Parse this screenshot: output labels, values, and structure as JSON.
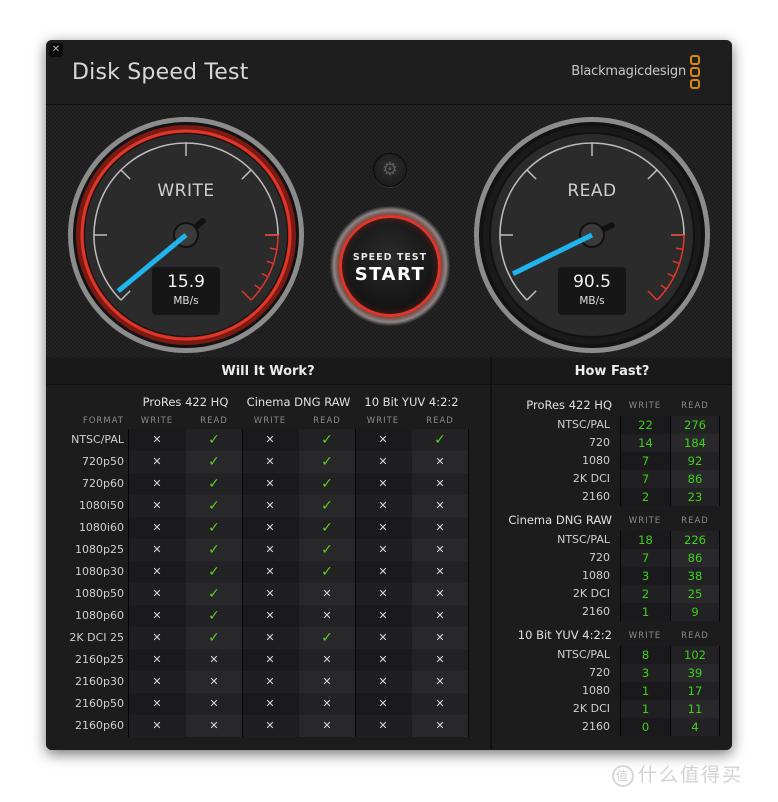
{
  "window": {
    "close_icon": "close-icon",
    "title": "Disk Speed Test",
    "brand": "Blackmagicdesign",
    "brand_logo_color": "#d68a15"
  },
  "gauges": {
    "write": {
      "label": "WRITE",
      "value": "15.9",
      "unit": "MB/s",
      "needle_fraction": 0.02,
      "ring_color": "#e0362a"
    },
    "read": {
      "label": "READ",
      "value": "90.5",
      "unit": "MB/s",
      "needle_fraction": 0.07,
      "ring_color": "#9a9a9a"
    },
    "needle_color": "#1fb4ee"
  },
  "controls": {
    "settings_icon": "gear-icon",
    "start_sub": "SPEED TEST",
    "start_main": "START"
  },
  "will_it_work": {
    "title": "Will It Work?",
    "format_header": "FORMAT",
    "codecs": [
      "ProRes 422 HQ",
      "Cinema DNG RAW",
      "10 Bit YUV 4:2:2"
    ],
    "subheaders": [
      "WRITE",
      "READ"
    ],
    "rows": [
      {
        "format": "NTSC/PAL",
        "cells": [
          "x",
          "ok",
          "x",
          "ok",
          "x",
          "ok"
        ]
      },
      {
        "format": "720p50",
        "cells": [
          "x",
          "ok",
          "x",
          "ok",
          "x",
          "x"
        ]
      },
      {
        "format": "720p60",
        "cells": [
          "x",
          "ok",
          "x",
          "ok",
          "x",
          "x"
        ]
      },
      {
        "format": "1080i50",
        "cells": [
          "x",
          "ok",
          "x",
          "ok",
          "x",
          "x"
        ]
      },
      {
        "format": "1080i60",
        "cells": [
          "x",
          "ok",
          "x",
          "ok",
          "x",
          "x"
        ]
      },
      {
        "format": "1080p25",
        "cells": [
          "x",
          "ok",
          "x",
          "ok",
          "x",
          "x"
        ]
      },
      {
        "format": "1080p30",
        "cells": [
          "x",
          "ok",
          "x",
          "ok",
          "x",
          "x"
        ]
      },
      {
        "format": "1080p50",
        "cells": [
          "x",
          "ok",
          "x",
          "x",
          "x",
          "x"
        ]
      },
      {
        "format": "1080p60",
        "cells": [
          "x",
          "ok",
          "x",
          "x",
          "x",
          "x"
        ]
      },
      {
        "format": "2K DCI 25",
        "cells": [
          "x",
          "ok",
          "x",
          "ok",
          "x",
          "x"
        ]
      },
      {
        "format": "2160p25",
        "cells": [
          "x",
          "x",
          "x",
          "x",
          "x",
          "x"
        ]
      },
      {
        "format": "2160p30",
        "cells": [
          "x",
          "x",
          "x",
          "x",
          "x",
          "x"
        ]
      },
      {
        "format": "2160p50",
        "cells": [
          "x",
          "x",
          "x",
          "x",
          "x",
          "x"
        ]
      },
      {
        "format": "2160p60",
        "cells": [
          "x",
          "x",
          "x",
          "x",
          "x",
          "x"
        ]
      }
    ],
    "check_color": "#59d11b",
    "cross_color": "#d4d4d4"
  },
  "how_fast": {
    "title": "How Fast?",
    "write_header": "WRITE",
    "read_header": "READ",
    "sections": [
      {
        "codec": "ProRes 422 HQ",
        "rows": [
          {
            "res": "NTSC/PAL",
            "write": "22",
            "read": "276"
          },
          {
            "res": "720",
            "write": "14",
            "read": "184"
          },
          {
            "res": "1080",
            "write": "7",
            "read": "92"
          },
          {
            "res": "2K DCI",
            "write": "7",
            "read": "86"
          },
          {
            "res": "2160",
            "write": "2",
            "read": "23"
          }
        ]
      },
      {
        "codec": "Cinema DNG RAW",
        "rows": [
          {
            "res": "NTSC/PAL",
            "write": "18",
            "read": "226"
          },
          {
            "res": "720",
            "write": "7",
            "read": "86"
          },
          {
            "res": "1080",
            "write": "3",
            "read": "38"
          },
          {
            "res": "2K DCI",
            "write": "2",
            "read": "25"
          },
          {
            "res": "2160",
            "write": "1",
            "read": "9"
          }
        ]
      },
      {
        "codec": "10 Bit YUV 4:2:2",
        "rows": [
          {
            "res": "NTSC/PAL",
            "write": "8",
            "read": "102"
          },
          {
            "res": "720",
            "write": "3",
            "read": "39"
          },
          {
            "res": "1080",
            "write": "1",
            "read": "17"
          },
          {
            "res": "2K DCI",
            "write": "1",
            "read": "11"
          },
          {
            "res": "2160",
            "write": "0",
            "read": "4"
          }
        ]
      }
    ],
    "value_color": "#3ed11a"
  },
  "watermark": {
    "badge": "值",
    "text": "什么值得买"
  }
}
